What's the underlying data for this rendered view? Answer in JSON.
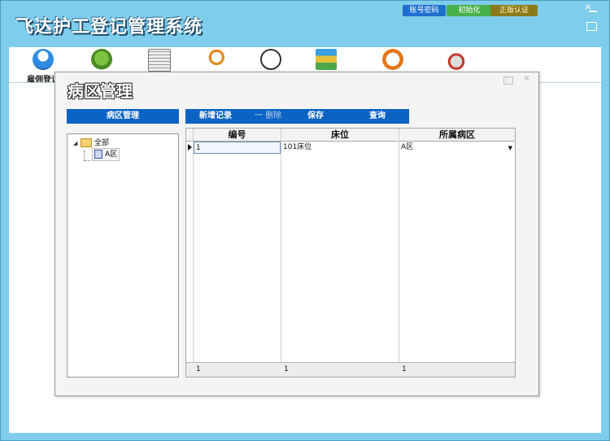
{
  "app": {
    "title": "飞达护工登记管理系统"
  },
  "header_buttons": {
    "account": "账号密码",
    "init": "初始化",
    "license": "正版认证"
  },
  "toolbar": {
    "items": [
      {
        "icon": "cloud-person-icon",
        "label": "雇佣登记"
      },
      {
        "icon": "coffee-cup-icon",
        "label": ""
      },
      {
        "icon": "newspaper-icon",
        "label": ""
      },
      {
        "icon": "magnifier-icon",
        "label": ""
      },
      {
        "icon": "clock-icon",
        "label": ""
      },
      {
        "icon": "books-icon",
        "label": ""
      },
      {
        "icon": "alarm-clock-icon",
        "label": ""
      },
      {
        "icon": "graduate-icon",
        "label": ""
      }
    ]
  },
  "dialog": {
    "title": "病区管理",
    "left_panel": {
      "header": "病区管理",
      "tree_root": "全部",
      "tree_child": "A区"
    },
    "actions": {
      "new": "新增记录",
      "delete": "一 删除",
      "save": "保存",
      "query": "查询"
    },
    "grid": {
      "columns": [
        "编号",
        "床位",
        "所属病区"
      ],
      "rows": [
        {
          "id": "1",
          "bed": "101床位",
          "ward": "A区"
        }
      ],
      "footer": [
        "1",
        "1",
        "1"
      ]
    }
  },
  "colors": {
    "accent": "#0b63c4",
    "frame": "#7fcdec"
  }
}
